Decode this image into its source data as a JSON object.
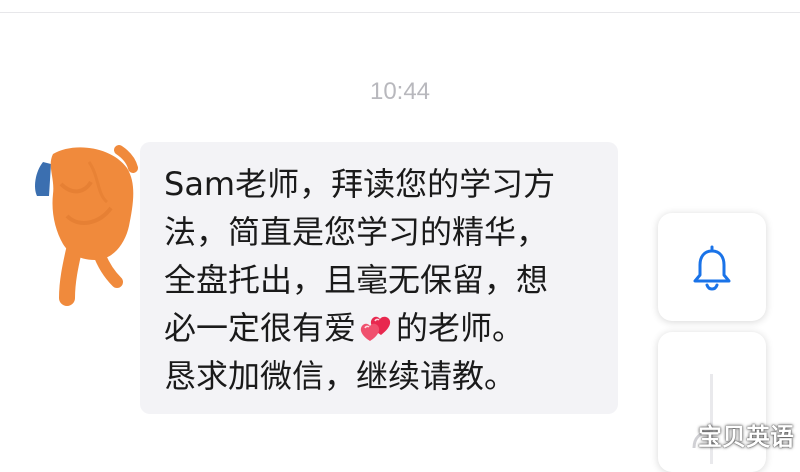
{
  "chat": {
    "timestamp": "10:44",
    "message": {
      "lines": [
        "Sam老师，拜读您的学习方",
        "法，简直是您学习的精华，",
        "全盘托出，且毫无保留，想"
      ],
      "line4_before_emoji": "必一定很有爱",
      "emoji": "two-hearts",
      "line4_after_emoji": "的老师。",
      "line5": "恳求加微信，继续请教。"
    }
  },
  "sidebar": {
    "bell_icon": "bell-icon"
  },
  "watermark": {
    "text": "宝贝英语"
  },
  "colors": {
    "bubble_bg": "#f3f3f6",
    "text": "#1a1a1a",
    "timestamp": "#b8b8bd",
    "accent_blue": "#1a73e8",
    "avatar_scribble": "#f08a3c",
    "avatar_base": "#3b6fb0",
    "heart": "#e8284f"
  }
}
